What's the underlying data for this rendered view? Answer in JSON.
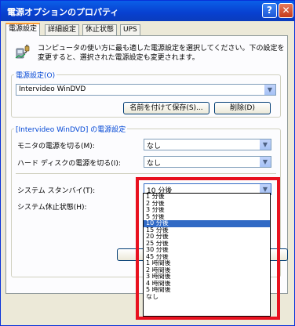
{
  "window": {
    "title": "電源オプションのプロパティ",
    "help_btn": "?",
    "close_btn": "✕"
  },
  "tabs": [
    {
      "label": "電源設定",
      "active": true
    },
    {
      "label": "詳細設定",
      "active": false
    },
    {
      "label": "休止状態",
      "active": false
    },
    {
      "label": "UPS",
      "active": false
    }
  ],
  "intro": {
    "line1": "コンピュータの使い方に最も適した電源設定を選択してください。下の設定を",
    "line2": "変更すると、選択された電源設定も変更されます。"
  },
  "scheme": {
    "legend": "電源設定(O)",
    "value": "Intervideo WinDVD",
    "save_as_label": "名前を付けて保存(S)...",
    "delete_label": "削除(D)"
  },
  "settings": {
    "legend": "[Intervideo WinDVD] の電源設定",
    "monitor_label": "モニタの電源を切る(M):",
    "monitor_value": "なし",
    "disk_label": "ハード ディスクの電源を切る(I):",
    "disk_value": "なし",
    "standby_label": "システム スタンバイ(T):",
    "standby_value": "10 分後",
    "hibernate_label": "システム休止状態(H):"
  },
  "dropdown": {
    "options": [
      "1 分後",
      "2 分後",
      "3 分後",
      "5 分後",
      "10 分後",
      "15 分後",
      "20 分後",
      "25 分後",
      "30 分後",
      "45 分後",
      "1 時間後",
      "2 時間後",
      "3 時間後",
      "4 時間後",
      "5 時間後",
      "なし"
    ],
    "selected_index": 4
  },
  "colors": {
    "accent_highlight": "#e8111f",
    "selection": "#316ac5",
    "title_bar": "#0840d0",
    "group_legend": "#0046d5"
  },
  "icons": {
    "power_options": "power-plug-icon",
    "combo_arrow": "chevron-down-icon"
  }
}
